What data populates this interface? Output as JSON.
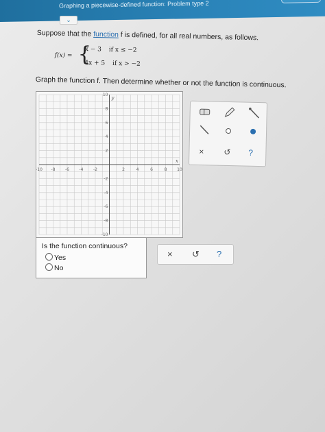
{
  "header": {
    "title": "Graphing a piecewise-defined function: Problem type 2"
  },
  "collapse_icon": "chevron-down-icon",
  "prompt": {
    "before_link": "Suppose that the ",
    "link": "function",
    "after_link": " f is defined, for all real numbers, as follows."
  },
  "formula": {
    "lhs": "f(x) =",
    "case1_expr": "x − 3",
    "case1_cond": "if x ≤ −2",
    "case2_expr": "4x + 5",
    "case2_cond": "if x > −2"
  },
  "instruction": "Graph the function f. Then determine whether or not the function is continuous.",
  "graph": {
    "x_axis_label": "x",
    "y_axis_label": "y",
    "x_ticks": [
      "-10",
      "-8",
      "-6",
      "-4",
      "-2",
      "2",
      "4",
      "6",
      "8",
      "10"
    ],
    "y_ticks": [
      "10",
      "8",
      "6",
      "4",
      "2",
      "-2",
      "-4",
      "-6",
      "-8",
      "-10"
    ],
    "range": [
      -10,
      10
    ]
  },
  "tools": {
    "eraser": "eraser-icon",
    "pencil": "pencil-icon",
    "ray": "ray-icon",
    "segment": "segment-icon",
    "open_point": "open-point-icon",
    "closed_point": "closed-point-icon",
    "clear": "×",
    "undo": "↺",
    "help": "?"
  },
  "question": {
    "text": "Is the function continuous?",
    "options": [
      "Yes",
      "No"
    ]
  },
  "actions": {
    "clear": "×",
    "undo": "↺",
    "help": "?"
  }
}
